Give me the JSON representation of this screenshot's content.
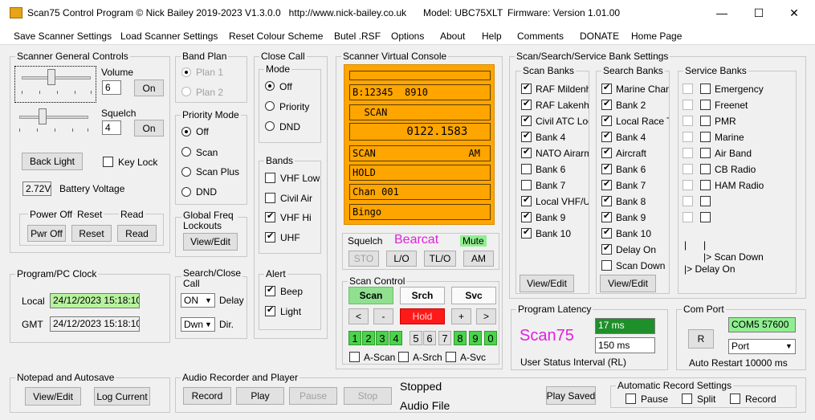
{
  "titlebar": {
    "title": "Scan75 Control Program © Nick Bailey 2019-2023 V1.3.0.0   http://www.nick-bailey.co.uk",
    "model": "Model: UBC75XLT",
    "firmware": "Firmware: Version 1.01.00",
    "minimize": "—",
    "maximize": "☐",
    "close": "✕"
  },
  "menu": [
    "Save Scanner Settings",
    "Load Scanner Settings",
    "Reset Colour Scheme",
    "Butel .RSF",
    "Options",
    "About",
    "Help",
    "Comments",
    "DONATE",
    "Home Page"
  ],
  "general": {
    "title": "Scanner General Controls",
    "volume_label": "Volume",
    "volume_value": "6",
    "volume_button": "On",
    "squelch_label": "Squelch",
    "squelch_value": "4",
    "squelch_button": "On",
    "backlight": "Back Light",
    "keylock": "Key Lock",
    "battery_value": "2.72V",
    "battery_label": "Battery Voltage",
    "power_off_label": "Power Off",
    "reset_label": "Reset",
    "read_label": "Read",
    "pwr_off_button": "Pwr Off",
    "reset_button": "Reset",
    "read_button": "Read"
  },
  "band_plan": {
    "title": "Band Plan",
    "plan1": "Plan 1",
    "plan2": "Plan 2"
  },
  "priority": {
    "title": "Priority Mode",
    "options": [
      "Off",
      "Scan",
      "Scan Plus",
      "DND"
    ]
  },
  "global_freq": {
    "title": "Global Freq Lockouts",
    "button": "View/Edit"
  },
  "close_call": {
    "title": "Close Call",
    "mode_title": "Mode",
    "modes": [
      "Off",
      "Priority",
      "DND"
    ]
  },
  "bands": {
    "title": "Bands",
    "items": [
      "VHF Low",
      "Civil Air",
      "VHF Hi",
      "UHF"
    ]
  },
  "alert": {
    "title": "Alert",
    "items": [
      "Beep",
      "Light"
    ]
  },
  "console": {
    "title": "Scanner Virtual Console",
    "lines": [
      "B:12345  8910",
      "  SCAN",
      "        0122.1583",
      "SCAN                AM",
      "HOLD",
      "Chan 001",
      "Bingo"
    ],
    "squelch_label": "Squelch",
    "brand": "Bearcat",
    "mute": "Mute",
    "buttons": [
      "STO",
      "L/O",
      "TL/O",
      "AM"
    ]
  },
  "scan_control": {
    "title": "Scan Control",
    "scan": "Scan",
    "srch": "Srch",
    "svc": "Svc",
    "lt": "<",
    "minus": "-",
    "hold": "Hold",
    "plus": "+",
    "gt": ">",
    "numbers": [
      "1",
      "2",
      "3",
      "4",
      "5",
      "6",
      "7",
      "8",
      "9",
      "0"
    ],
    "ascan": "A-Scan",
    "asrch": "A-Srch",
    "asvc": "A-Svc"
  },
  "banks": {
    "title": "Scan/Search/Service Bank Settings",
    "scan_title": "Scan Banks",
    "scan_items": [
      "RAF Mildenhal",
      "RAF Lakenhea",
      "Civil ATC Loca",
      "Bank 4",
      "NATO Airarms",
      "Bank 6",
      "Bank 7",
      "Local VHF/UH",
      "Bank 9",
      "Bank 10"
    ],
    "search_title": "Search Banks",
    "search_items": [
      "Marine Channe",
      "Bank 2",
      "Local Race Tr",
      "Bank 4",
      "Aircraft",
      "Bank 6",
      "Bank 7",
      "Bank 8",
      "Bank 9",
      "Bank 10",
      "Delay On",
      "Scan Down"
    ],
    "service_title": "Service Banks",
    "service_items": [
      "Emergency",
      "Freenet",
      "PMR",
      "Marine",
      "Air Band",
      "CB Radio",
      "HAM Radio"
    ],
    "scan_down_note": "> Scan Down",
    "delay_on_note": "> Delay On",
    "view_edit": "View/Edit"
  },
  "clock": {
    "title": "Program/PC Clock",
    "local_label": "Local",
    "local_value": "24/12/2023 15:18:10",
    "gmt_label": "GMT",
    "gmt_value": "24/12/2023 15:18:10"
  },
  "search_close": {
    "title": "Search/Close Call",
    "delay_value": "ON",
    "delay_label": "Delay",
    "dir_value": "Dwn",
    "dir_label": "Dir."
  },
  "latency": {
    "title": "Program Latency",
    "brand": "Scan75",
    "ms1": "17 ms",
    "ms2": "150 ms",
    "interval_label": "User Status Interval (RL)"
  },
  "com_port": {
    "title": "Com Port",
    "r_button": "R",
    "port_value": "COM5 57600",
    "port_select": "Port",
    "auto_restart": "Auto Restart 10000 ms"
  },
  "notepad": {
    "title": "Notepad and Autosave",
    "view_edit": "View/Edit",
    "log_current": "Log Current"
  },
  "audio": {
    "title": "Audio Recorder and Player",
    "record": "Record",
    "play": "Play",
    "pause": "Pause",
    "stop": "Stop",
    "status": "Stopped",
    "file_label": "Audio File",
    "play_saved": "Play Saved"
  },
  "auto_record": {
    "title": "Automatic Record Settings",
    "items": [
      "Pause",
      "Split",
      "Record"
    ]
  },
  "colors": {
    "lcd": "#ffa500",
    "mute": "#90ee90",
    "brand": "#e020e0",
    "hold": "#ff1a1a",
    "scan_green": "#8fe08f"
  }
}
